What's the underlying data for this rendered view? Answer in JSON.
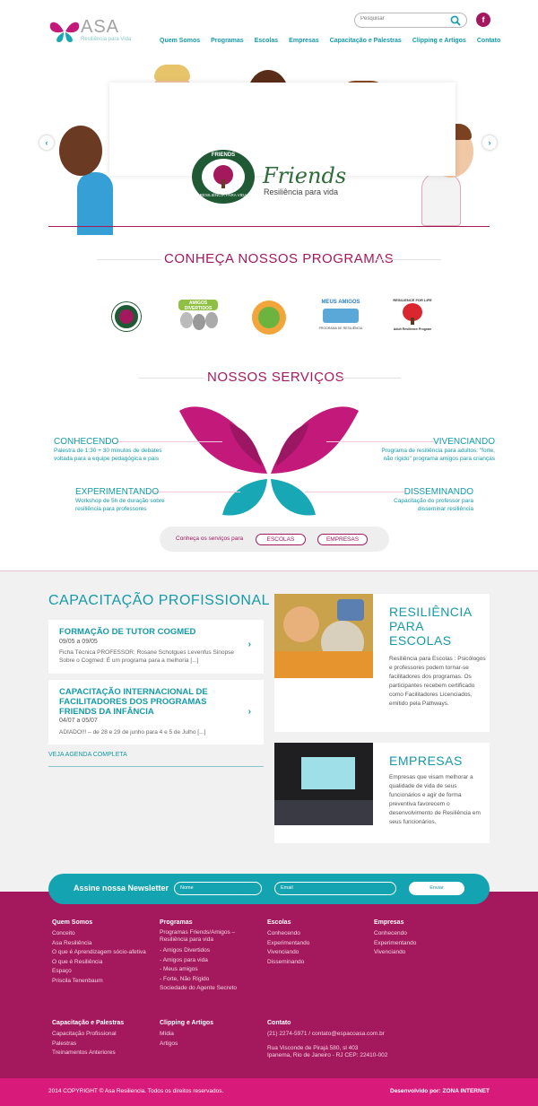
{
  "brand": {
    "name": "ASA",
    "tagline": "Resiliência para Vida",
    "colors": {
      "magenta": "#a4195e",
      "teal": "#149aa8",
      "pink_bar": "#d81b7a"
    }
  },
  "header": {
    "search_placeholder": "Pesquisar",
    "facebook_label": "f",
    "nav": [
      "Quem Somos",
      "Programas",
      "Escolas",
      "Empresas",
      "Capacitação e Palestras",
      "Clipping e Artigos",
      "Contato"
    ]
  },
  "hero": {
    "badge_top": "FRIENDS",
    "badge_bottom": "RESILIÊNCIA PARA VIDA",
    "word": "Friends",
    "subtitle": "Resiliência para vida",
    "prev": "‹",
    "next": "›"
  },
  "programs": {
    "title": "CONHEÇA NOSSOS PROGRAMAS",
    "logos": [
      {
        "label": ""
      },
      {
        "label": "AMIGOS DIVERTIDOS"
      },
      {
        "label": ""
      },
      {
        "label": "MEUS AMIGOS",
        "sub": "PROGRAMA DE RESILIÊNCIA"
      },
      {
        "label": "RESILIENCE FOR LIFE",
        "sub": "Adult Resilience Program"
      }
    ]
  },
  "services": {
    "title": "NOSSOS SERVIÇOS",
    "items": [
      {
        "head": "CONHECENDO",
        "text": "Palestra de 1:30 + 30 minutos de debates voltada para a equipe pedagógica e pais"
      },
      {
        "head": "VIVENCIANDO",
        "text": "Programa de resiliência para adultos: \"forte, não rígido\" programa amigos para crianças"
      },
      {
        "head": "EXPERIMENTANDO",
        "text": "Workshop de 5h de duração sobre resiliência para professores"
      },
      {
        "head": "DISSEMINANDO",
        "text": "Capacitação do professor para disseminar resiliência"
      }
    ],
    "bar_label": "Conheça os serviços para",
    "btn_escolas": "ESCOLAS",
    "btn_empresas": "EMPRESAS"
  },
  "capacitacao": {
    "title": "CAPACITAÇÃO PROFISSIONAL",
    "cards": [
      {
        "title": "FORMAÇÃO DE TUTOR COGMED",
        "date": "09/05 a 09/05",
        "text": "Ficha Técnica PROFESSOR: Rosane Schotgues Levenfus Sinopse Sobre o Cogmed: É um programa para a melhoria [...]"
      },
      {
        "title": "CAPACITAÇÃO INTERNACIONAL DE FACILITADORES DOS PROGRAMAS FRIENDS DA INFÂNCIA",
        "date": "04/07 a 05/07",
        "text": "ADIADO!!! – de 28 e 29 de junho para 4 e 5 de Julho  [...]"
      }
    ],
    "agenda_link": "VEJA AGENDA COMPLETA",
    "chevron": "›"
  },
  "features": [
    {
      "title": "RESILIÊNCIA PARA ESCOLAS",
      "text": "Resiliência para Escolas : Psicólogos e professores podem tornar-se facilitadores dos programas. Os participantes recebem certificado como Facilitadores Licenciados, emitido pela Pathways."
    },
    {
      "title": "EMPRESAS",
      "text": "Empresas que visam melhorar a qualidade de vida de seus funcionários e agir de forma preventiva favorecem o desenvolvimento de Resiliência em seus funcionários."
    }
  ],
  "newsletter": {
    "label": "Assine nossa Newsletter",
    "name_placeholder": "Nome",
    "email_placeholder": "Email",
    "button": "Enviar"
  },
  "footer": {
    "columns": [
      {
        "head": "Quem Somos",
        "items": [
          "Conceito",
          "Asa Resiliência",
          "O que é Aprendizagem sócio-afetiva",
          "O que é Resiliência",
          "Espaço",
          "Priscila Tenenbaum"
        ]
      },
      {
        "head": "Programas",
        "items": [
          "Programas Friends/Amigos – Resiliência para vida",
          "- Amigos Divertidos",
          "- Amigos para vida",
          "- Meus amigos",
          "- Forte, Não Rígido",
          "Sociedade do Agente Secreto"
        ]
      },
      {
        "head": "Escolas",
        "items": [
          "Conhecendo",
          "Experimentando",
          "Vivenciando",
          "Disseminando"
        ]
      },
      {
        "head": "Empresas",
        "items": [
          "Conhecendo",
          "Experimentando",
          "Vivenciando"
        ]
      },
      {
        "head": "Capacitação e Palestras",
        "items": [
          "Capacitação Profissional",
          "Palestras",
          "Treinamentos Anteriores"
        ]
      },
      {
        "head": "Clipping e Artigos",
        "items": [
          "Mídia",
          "Artigos"
        ]
      },
      {
        "head": "Contato",
        "items": [
          "(21) 2274-5971 / contato@espacoasa.com.br",
          "",
          "Rua Visconde de Pirajá 580, sl 403",
          "Ipanema, Rio de Janeiro - RJ CEP: 22410-002"
        ]
      }
    ],
    "copyright": "2014 COPYRIGHT © Asa Resiliencia. Todos os direitos reservados.",
    "developer": "Desenvolvido por: ZONA INTERNET"
  }
}
